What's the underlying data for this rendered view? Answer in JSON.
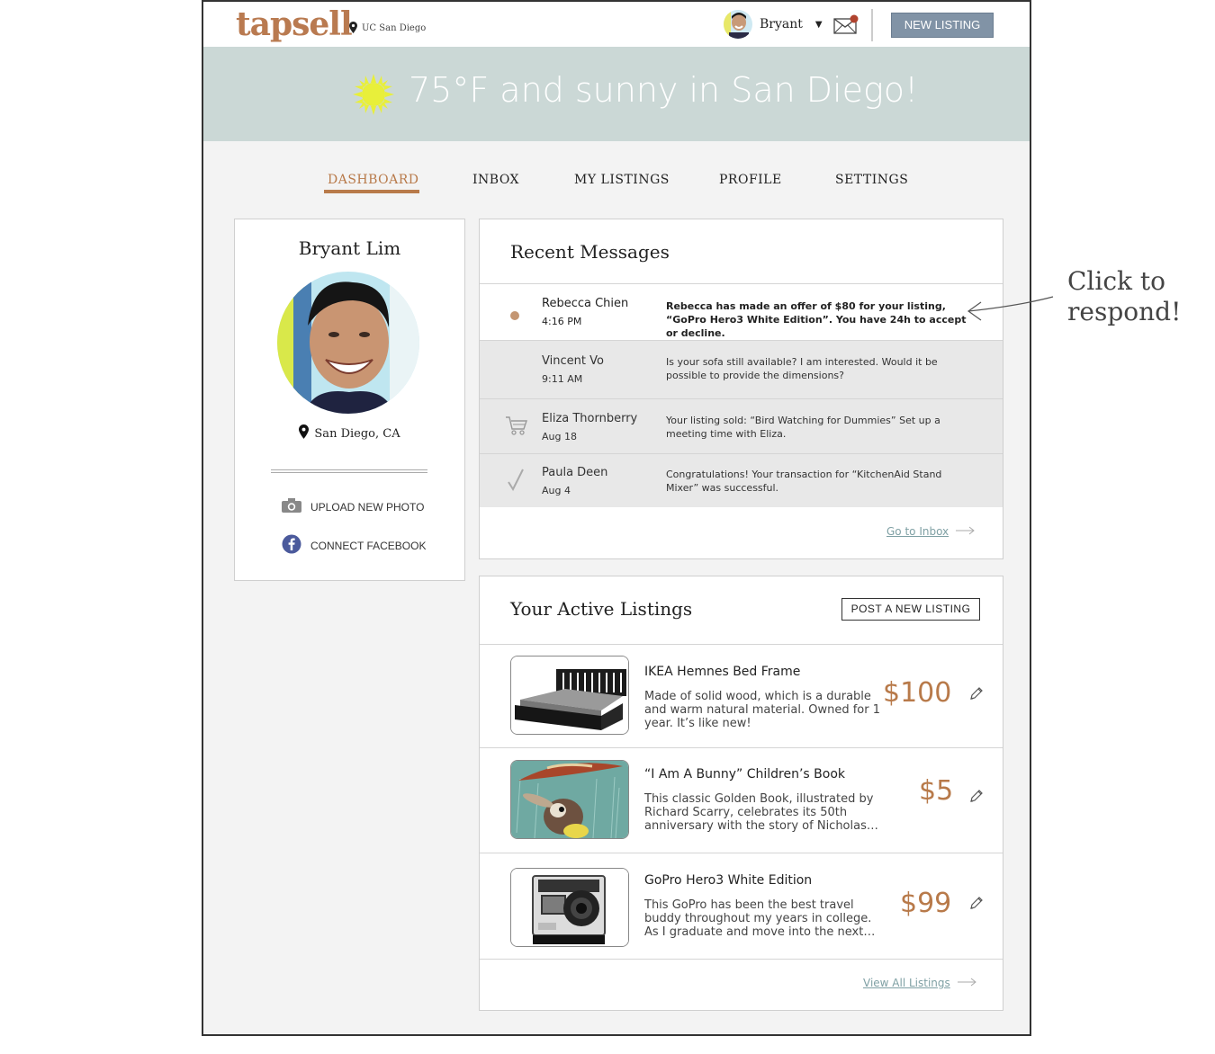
{
  "app": {
    "logo": "tapsell",
    "location": "UC San Diego"
  },
  "header": {
    "user_name": "Bryant",
    "caret": "▼",
    "mail_icon": "mail-icon",
    "new_listing_label": "NEW LISTING"
  },
  "banner": {
    "weather": "75°F and sunny in San Diego!",
    "icon": "sun-icon"
  },
  "tabs": [
    {
      "label": "DASHBOARD",
      "active": true
    },
    {
      "label": "INBOX"
    },
    {
      "label": "MY LISTINGS"
    },
    {
      "label": "PROFILE"
    },
    {
      "label": "SETTINGS"
    }
  ],
  "profile": {
    "name": "Bryant Lim",
    "location": "San Diego, CA",
    "actions": [
      {
        "label": "UPLOAD NEW PHOTO",
        "icon": "camera-icon"
      },
      {
        "label": "CONNECT FACEBOOK",
        "icon": "facebook-icon"
      }
    ]
  },
  "messages": {
    "title": "Recent Messages",
    "items": [
      {
        "name": "Rebecca Chien",
        "time": "4:16 PM",
        "body": "Rebecca has made an offer of $80 for your listing, “GoPro Hero3 White Edition”. You have 24h to accept or decline.",
        "icon": "unread-dot-icon",
        "unread": true
      },
      {
        "name": "Vincent Vo",
        "time": "9:11 AM",
        "body": "Is your sofa still available? I am interested. Would it be possible to provide the dimensions?",
        "icon": ""
      },
      {
        "name": "Eliza Thornberry",
        "time": "Aug 18",
        "body": "Your listing sold: “Bird Watching for Dummies” Set up a meeting time with Eliza.",
        "icon": "cart-icon"
      },
      {
        "name": "Paula Deen",
        "time": "Aug 4",
        "body": "Congratulations! Your transaction for “KitchenAid Stand Mixer” was successful.",
        "icon": "checkmark-icon"
      }
    ],
    "link": "Go to Inbox"
  },
  "listings": {
    "title": "Your Active Listings",
    "post_label": "POST A NEW LISTING",
    "items": [
      {
        "title": "IKEA Hemnes Bed Frame",
        "desc": "Made of solid wood, which is a durable and warm natural material. Owned for 1 year. It’s like new!",
        "price": "$100"
      },
      {
        "title": "“I Am A Bunny” Children’s Book",
        "desc": "This classic Golden Book, illustrated by Richard Scarry, celebrates its 50th anniversary with the story of Nicholas…",
        "price": "$5"
      },
      {
        "title": "GoPro Hero3 White Edition",
        "desc": "This GoPro has been the best travel buddy throughout my years in college. As I graduate and move into the next…",
        "price": "$99"
      }
    ],
    "link": "View All Listings"
  },
  "annotation": {
    "line1": "Click to",
    "line2": "respond!"
  },
  "colors": {
    "accent": "#b87a4a",
    "banner": "#cbd8d6",
    "button": "#8193a6",
    "link": "#7fa0a4"
  }
}
